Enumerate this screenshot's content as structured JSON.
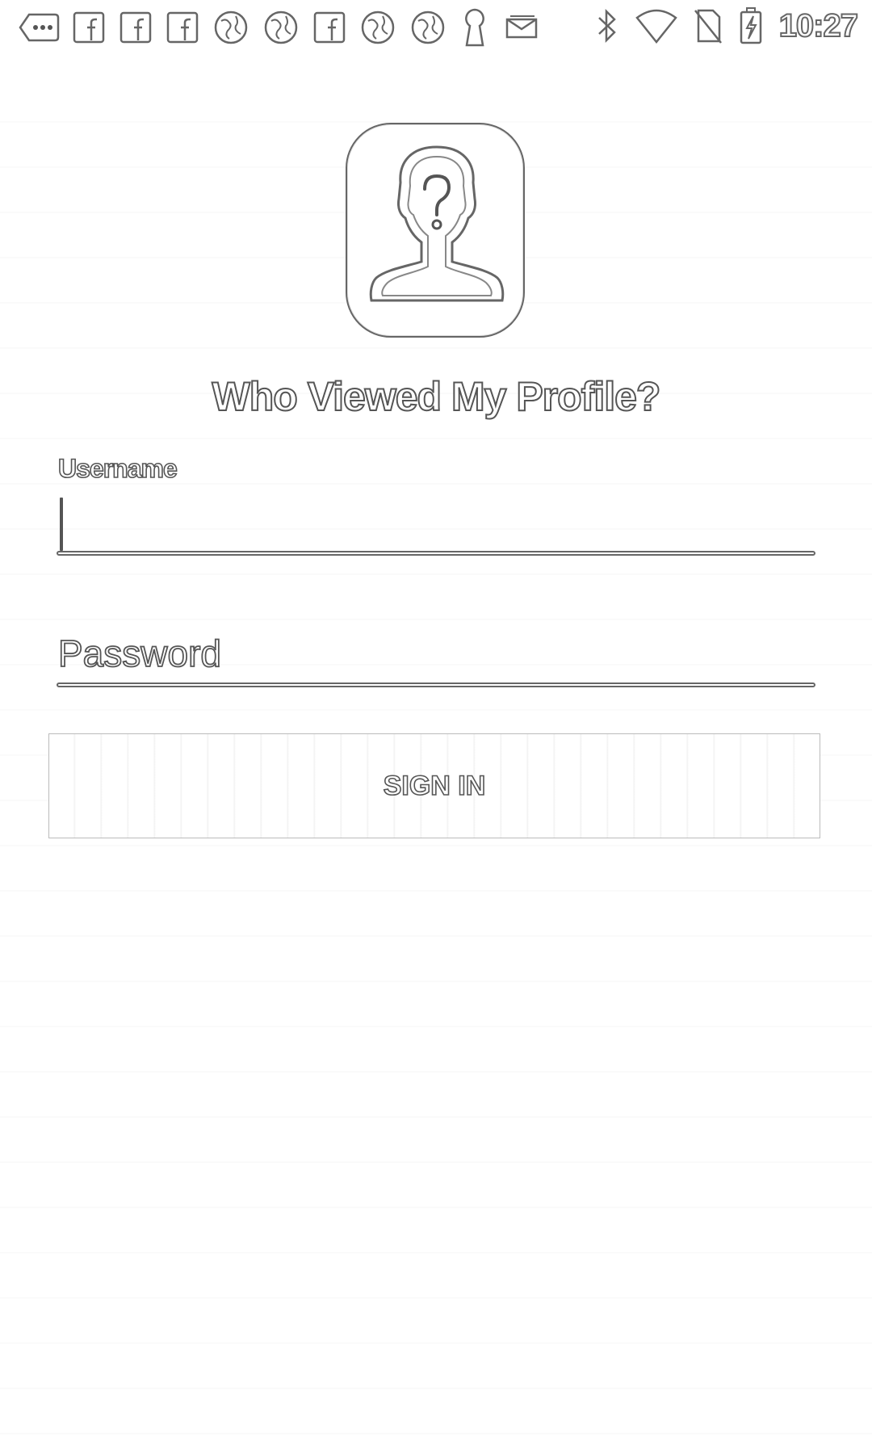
{
  "status_bar": {
    "time": "10:27",
    "notification_icons": [
      "more-icon",
      "facebook-icon",
      "facebook-icon",
      "facebook-icon",
      "globe-icon",
      "globe-icon",
      "facebook-icon",
      "globe-icon",
      "globe-icon",
      "keyhole-icon",
      "mail-icon"
    ],
    "system_icons": [
      "bluetooth-icon",
      "wifi-icon",
      "no-sim-icon",
      "battery-charging-icon"
    ]
  },
  "app": {
    "title": "Who Viewed My Profile?",
    "logo_icon": "unknown-person-icon"
  },
  "form": {
    "username_label": "Username",
    "username_value": "",
    "password_placeholder": "Password",
    "password_value": "",
    "sign_in_label": "SIGN IN"
  }
}
